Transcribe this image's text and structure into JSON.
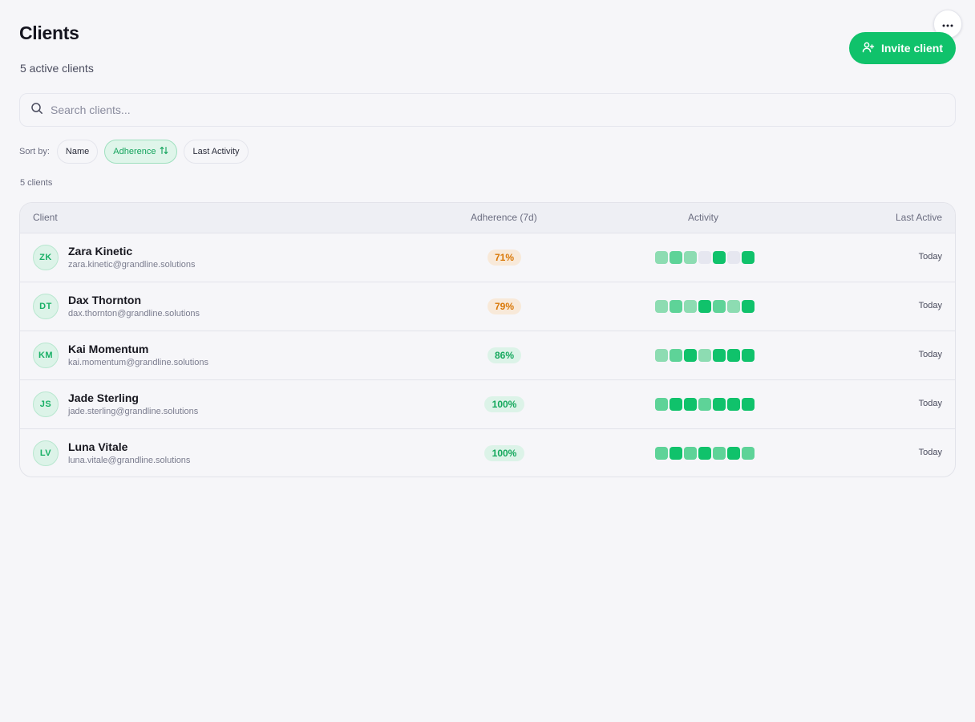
{
  "header": {
    "title": "Clients",
    "subtitle": "5 active clients",
    "invite_label": "Invite client",
    "more_icon": "ellipsis-icon"
  },
  "search": {
    "placeholder": "Search clients...",
    "value": ""
  },
  "sort": {
    "label": "Sort by:",
    "options": [
      {
        "label": "Name",
        "active": false
      },
      {
        "label": "Adherence",
        "active": true,
        "icon": "sort-arrows-icon"
      },
      {
        "label": "Last Activity",
        "active": false
      }
    ]
  },
  "count_label": "5 clients",
  "table": {
    "columns": [
      "Client",
      "Adherence (7d)",
      "Activity",
      "Last Active"
    ],
    "rows": [
      {
        "initials": "ZK",
        "name": "Zara Kinetic",
        "email": "zara.kinetic@grandline.solutions",
        "adherence": "71%",
        "activity": [
          1,
          2,
          1,
          0,
          3,
          0,
          3
        ],
        "last_active": "Today"
      },
      {
        "initials": "DT",
        "name": "Dax Thornton",
        "email": "dax.thornton@grandline.solutions",
        "adherence": "79%",
        "activity": [
          1,
          2,
          1,
          3,
          2,
          1,
          3
        ],
        "last_active": "Today"
      },
      {
        "initials": "KM",
        "name": "Kai Momentum",
        "email": "kai.momentum@grandline.solutions",
        "adherence": "86%",
        "activity": [
          1,
          2,
          3,
          1,
          3,
          3,
          3
        ],
        "last_active": "Today"
      },
      {
        "initials": "JS",
        "name": "Jade Sterling",
        "email": "jade.sterling@grandline.solutions",
        "adherence": "100%",
        "activity": [
          2,
          3,
          3,
          2,
          3,
          3,
          3
        ],
        "last_active": "Today"
      },
      {
        "initials": "LV",
        "name": "Luna Vitale",
        "email": "luna.vitale@grandline.solutions",
        "adherence": "100%",
        "activity": [
          2,
          3,
          2,
          3,
          2,
          3,
          2
        ],
        "last_active": "Today"
      }
    ]
  },
  "colors": {
    "accent": "#10c26b",
    "warning": "#d97706",
    "activity_levels": [
      "#e6e7f0",
      "#8ddcb2",
      "#5ed398",
      "#10c26b"
    ]
  }
}
